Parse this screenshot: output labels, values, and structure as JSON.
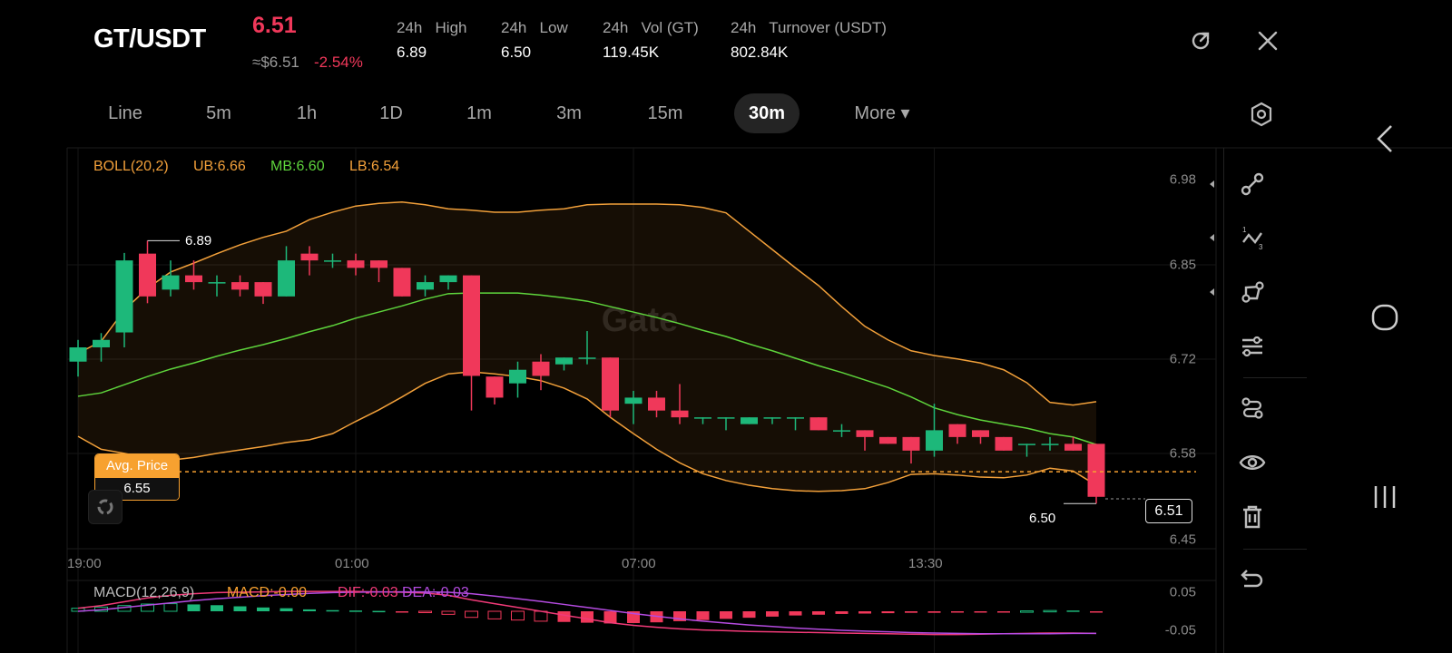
{
  "header": {
    "pair": "GT/USDT",
    "last_price": "6.51",
    "usd_price": "≈$6.51",
    "change_pct": "-2.54%",
    "stats": [
      {
        "label": "24h   High",
        "value": "6.89"
      },
      {
        "label": "24h   Low",
        "value": "6.50"
      },
      {
        "label": "24h   Vol (GT)",
        "value": "119.45K"
      },
      {
        "label": "24h   Turnover (USDT)",
        "value": "802.84K"
      }
    ],
    "icons": {
      "refresh": "refresh-icon",
      "close": "close-icon"
    }
  },
  "tabs": [
    {
      "label": "Line"
    },
    {
      "label": "5m"
    },
    {
      "label": "1h"
    },
    {
      "label": "1D"
    },
    {
      "label": "1m"
    },
    {
      "label": "3m"
    },
    {
      "label": "15m"
    },
    {
      "label": "30m",
      "selected": true
    },
    {
      "label": "More ▾"
    }
  ],
  "indicators": {
    "boll": {
      "name": "BOLL(20,2)",
      "ub": "UB:6.66",
      "mb": "MB:6.60",
      "lb": "LB:6.54"
    },
    "macd": {
      "name": "MACD(12,26,9)",
      "macd": "MACD:-0.00",
      "dif": "DIF:-0.03",
      "dea": "DEA:-0.03"
    }
  },
  "avg_price": {
    "label": "Avg. Price",
    "value": "6.55"
  },
  "current_price_tag": "6.51",
  "high_marker": "6.89",
  "low_marker": "6.50",
  "watermark": "Gate",
  "colors": {
    "up": "#1db87a",
    "down": "#f0385a",
    "boll_band": "#f2a03a",
    "boll_mid": "#5ed43c",
    "dif": "#f03a78",
    "dea": "#b44be0",
    "accent": "#f7a130"
  },
  "chart_data": {
    "type": "candlestick",
    "interval": "30m",
    "ylim": [
      6.45,
      6.98
    ],
    "y_ticks": [
      "6.98",
      "6.85",
      "6.72",
      "6.58",
      "6.45"
    ],
    "x_ticks": [
      {
        "label": "19:00",
        "index": 0
      },
      {
        "label": "01:00",
        "index": 12
      },
      {
        "label": "07:00",
        "index": 24
      },
      {
        "label": "13:30",
        "index": 37
      }
    ],
    "candles": [
      [
        6.712,
        6.744,
        6.69,
        6.733
      ],
      [
        6.733,
        6.754,
        6.712,
        6.744
      ],
      [
        6.755,
        6.872,
        6.733,
        6.861
      ],
      [
        6.871,
        6.89,
        6.798,
        6.808
      ],
      [
        6.818,
        6.861,
        6.808,
        6.839
      ],
      [
        6.839,
        6.861,
        6.818,
        6.829
      ],
      [
        6.829,
        6.839,
        6.808,
        6.829
      ],
      [
        6.829,
        6.839,
        6.808,
        6.818
      ],
      [
        6.829,
        6.829,
        6.797,
        6.808
      ],
      [
        6.808,
        6.882,
        6.808,
        6.861
      ],
      [
        6.871,
        6.882,
        6.839,
        6.861
      ],
      [
        6.861,
        6.871,
        6.85,
        6.861
      ],
      [
        6.861,
        6.871,
        6.839,
        6.85
      ],
      [
        6.861,
        6.861,
        6.829,
        6.85
      ],
      [
        6.85,
        6.85,
        6.808,
        6.808
      ],
      [
        6.818,
        6.839,
        6.808,
        6.829
      ],
      [
        6.829,
        6.839,
        6.818,
        6.839
      ],
      [
        6.839,
        6.839,
        6.64,
        6.691
      ],
      [
        6.69,
        6.69,
        6.649,
        6.659
      ],
      [
        6.68,
        6.712,
        6.659,
        6.7
      ],
      [
        6.712,
        6.723,
        6.67,
        6.691
      ],
      [
        6.708,
        6.718,
        6.699,
        6.718
      ],
      [
        6.718,
        6.757,
        6.708,
        6.718
      ],
      [
        6.718,
        6.718,
        6.63,
        6.64
      ],
      [
        6.65,
        6.669,
        6.62,
        6.659
      ],
      [
        6.659,
        6.669,
        6.63,
        6.64
      ],
      [
        6.64,
        6.679,
        6.62,
        6.63
      ],
      [
        6.63,
        6.63,
        6.62,
        6.63
      ],
      [
        6.63,
        6.63,
        6.611,
        6.63
      ],
      [
        6.62,
        6.63,
        6.62,
        6.63
      ],
      [
        6.63,
        6.63,
        6.62,
        6.63
      ],
      [
        6.63,
        6.63,
        6.611,
        6.63
      ],
      [
        6.63,
        6.63,
        6.611,
        6.611
      ],
      [
        6.611,
        6.62,
        6.601,
        6.611
      ],
      [
        6.611,
        6.611,
        6.581,
        6.601
      ],
      [
        6.601,
        6.601,
        6.591,
        6.591
      ],
      [
        6.601,
        6.601,
        6.562,
        6.581
      ],
      [
        6.581,
        6.65,
        6.572,
        6.611
      ],
      [
        6.62,
        6.62,
        6.591,
        6.601
      ],
      [
        6.611,
        6.611,
        6.591,
        6.601
      ],
      [
        6.601,
        6.601,
        6.581,
        6.581
      ],
      [
        6.591,
        6.591,
        6.572,
        6.591
      ],
      [
        6.591,
        6.601,
        6.581,
        6.591
      ],
      [
        6.591,
        6.601,
        6.581,
        6.581
      ],
      [
        6.591,
        6.591,
        6.503,
        6.513
      ]
    ],
    "candle_fields": [
      "open",
      "high",
      "low",
      "close"
    ],
    "boll_ub": [
      6.724,
      6.742,
      6.788,
      6.82,
      6.844,
      6.857,
      6.871,
      6.884,
      6.895,
      6.904,
      6.921,
      6.932,
      6.941,
      6.945,
      6.947,
      6.943,
      6.937,
      6.935,
      6.932,
      6.932,
      6.935,
      6.937,
      6.943,
      6.944,
      6.944,
      6.944,
      6.943,
      6.939,
      6.931,
      6.904,
      6.877,
      6.85,
      6.824,
      6.793,
      6.764,
      6.744,
      6.728,
      6.721,
      6.716,
      6.71,
      6.7,
      6.681,
      6.652,
      6.648,
      6.653
    ],
    "boll_mb": [
      6.661,
      6.666,
      6.678,
      6.69,
      6.701,
      6.71,
      6.72,
      6.729,
      6.737,
      6.746,
      6.756,
      6.765,
      6.776,
      6.785,
      6.794,
      6.804,
      6.812,
      6.813,
      6.813,
      6.813,
      6.81,
      6.806,
      6.801,
      6.793,
      6.785,
      6.777,
      6.768,
      6.758,
      6.749,
      6.738,
      6.728,
      6.717,
      6.706,
      6.696,
      6.685,
      6.674,
      6.66,
      6.644,
      6.634,
      6.626,
      6.62,
      6.614,
      6.606,
      6.601,
      6.59
    ],
    "boll_lb": [
      6.602,
      6.583,
      6.577,
      6.57,
      6.567,
      6.571,
      6.577,
      6.582,
      6.587,
      6.593,
      6.597,
      6.606,
      6.624,
      6.641,
      6.66,
      6.68,
      6.694,
      6.697,
      6.694,
      6.69,
      6.684,
      6.673,
      6.657,
      6.63,
      6.606,
      6.583,
      6.563,
      6.547,
      6.537,
      6.53,
      6.525,
      6.522,
      6.521,
      6.522,
      6.525,
      6.534,
      6.546,
      6.547,
      6.545,
      6.542,
      6.541,
      6.545,
      6.555,
      6.551,
      6.53
    ],
    "macd_ylim_labels": [
      "0.05",
      "-0.05"
    ],
    "macd_hist": [
      0.008,
      0.011,
      0.015,
      0.019,
      0.02,
      0.018,
      0.016,
      0.013,
      0.01,
      0.008,
      0.005,
      0.003,
      0.002,
      0.001,
      -0.001,
      -0.003,
      -0.008,
      -0.016,
      -0.02,
      -0.023,
      -0.026,
      -0.028,
      -0.03,
      -0.032,
      -0.031,
      -0.029,
      -0.026,
      -0.023,
      -0.02,
      -0.017,
      -0.014,
      -0.011,
      -0.009,
      -0.007,
      -0.006,
      -0.005,
      -0.004,
      -0.004,
      -0.003,
      -0.001,
      -0.0005,
      0.001,
      0.002,
      0.002,
      -0.001
    ],
    "macd_dif": [
      0.008,
      0.015,
      0.025,
      0.035,
      0.042,
      0.046,
      0.049,
      0.05,
      0.051,
      0.052,
      0.052,
      0.052,
      0.052,
      0.051,
      0.05,
      0.048,
      0.042,
      0.03,
      0.02,
      0.01,
      0.0,
      -0.01,
      -0.02,
      -0.03,
      -0.037,
      -0.042,
      -0.046,
      -0.049,
      -0.051,
      -0.053,
      -0.054,
      -0.055,
      -0.056,
      -0.057,
      -0.058,
      -0.059,
      -0.06,
      -0.061,
      -0.061,
      -0.06,
      -0.059,
      -0.058,
      -0.057,
      -0.057,
      -0.058
    ],
    "macd_dea": [
      0.0,
      0.004,
      0.01,
      0.016,
      0.022,
      0.028,
      0.033,
      0.037,
      0.041,
      0.044,
      0.047,
      0.049,
      0.05,
      0.051,
      0.051,
      0.051,
      0.05,
      0.046,
      0.04,
      0.033,
      0.026,
      0.018,
      0.01,
      0.002,
      -0.006,
      -0.013,
      -0.02,
      -0.026,
      -0.031,
      -0.036,
      -0.04,
      -0.044,
      -0.047,
      -0.05,
      -0.052,
      -0.054,
      -0.056,
      -0.057,
      -0.058,
      -0.059,
      -0.059,
      -0.059,
      -0.059,
      -0.058,
      -0.058
    ]
  },
  "toolbar": [
    "line-tool-icon",
    "fibonacci-tool-icon",
    "shape-tool-icon",
    "settings-sliders-icon",
    "path-icon",
    "eye-icon",
    "trash-icon",
    "undo-icon"
  ],
  "system_nav": [
    "back-icon",
    "home-icon",
    "recents-icon"
  ]
}
